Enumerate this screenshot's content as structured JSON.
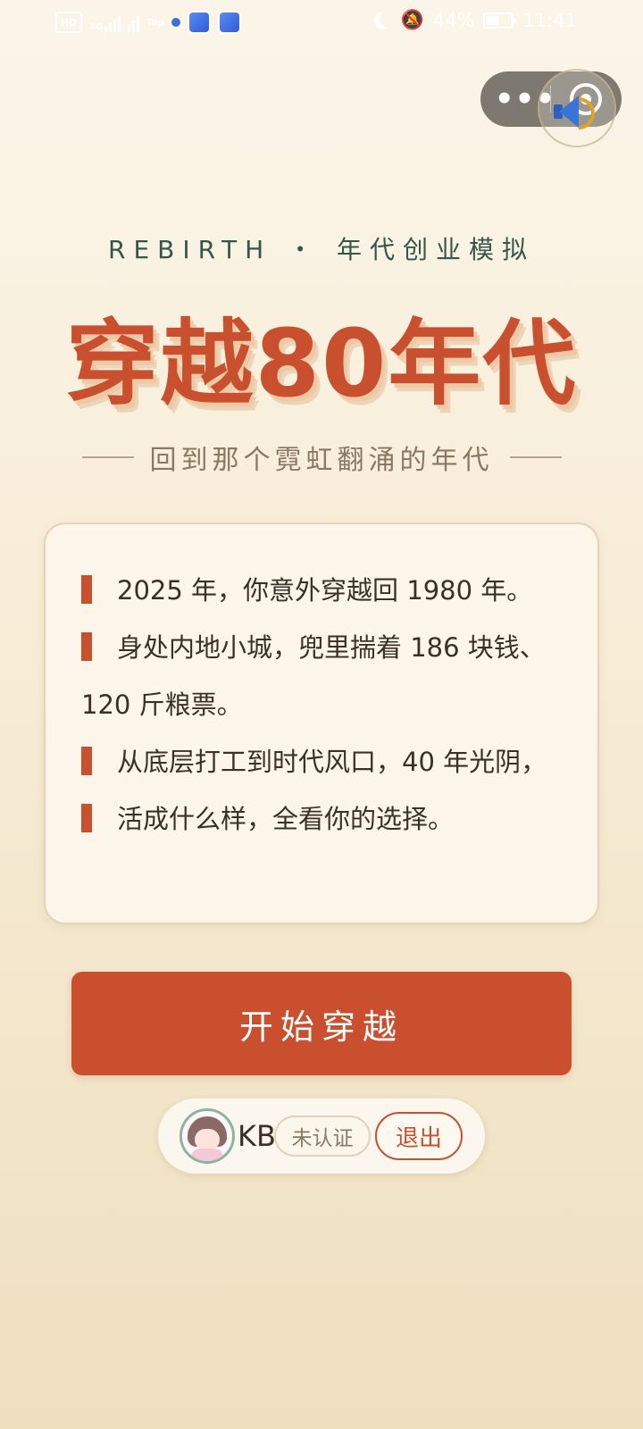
{
  "status_bar": {
    "network_label": "HD",
    "signal_label": "4G",
    "wifi_speed_label": "Top",
    "battery_percent": "44%",
    "time": "11:41"
  },
  "capsule": {
    "more_icon": "more-dots-icon",
    "close_icon": "circle-target-icon"
  },
  "floating_audio": {
    "icon": "speaker-icon"
  },
  "header": {
    "eyebrow": "REBIRTH ・ 年代创业模拟",
    "title": "穿越80年代",
    "subtitle": "回到那个霓虹翻涌的年代"
  },
  "story": {
    "lines": [
      "2025 年，你意外穿越回 1980 年。",
      "身处内地小城，兜里揣着 186 块钱、120 斤粮票。",
      "从底层打工到时代风口，40 年光阴，",
      "活成什么样，全看你的选择。"
    ]
  },
  "actions": {
    "start_label": "开始穿越"
  },
  "user": {
    "name": "KB",
    "verify_status": "未认证",
    "logout_label": "退出"
  },
  "colors": {
    "accent": "#c8502f",
    "eyebrow": "#35574b",
    "background_top": "#fbf5e9",
    "background_bottom": "#eedfbf"
  }
}
